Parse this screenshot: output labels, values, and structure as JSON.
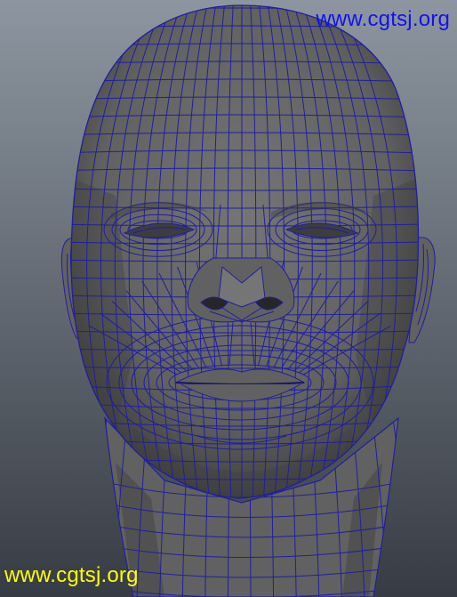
{
  "viewport": {
    "background_top": "#8d96a0",
    "background_bottom": "#373c44",
    "mesh_fill": "#616161",
    "mesh_fill_light": "#757575",
    "mesh_fill_dark": "#3d3d3d",
    "wire_color": "#1f1f9e"
  },
  "watermarks": {
    "top": {
      "text": "www.cgtsj.org",
      "color": "#1212ee"
    },
    "bottom": {
      "text": "www.cgtsj.org",
      "color": "#ffff00"
    }
  }
}
